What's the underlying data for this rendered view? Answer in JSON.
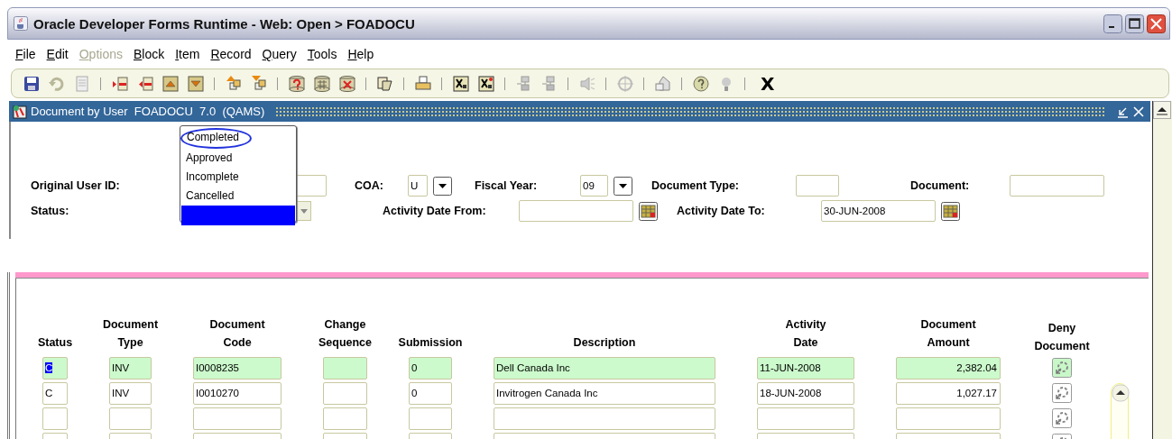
{
  "window": {
    "title": "Oracle Developer Forms Runtime - Web:  Open > FOADOCU"
  },
  "menu": [
    {
      "label": "File",
      "disabled": false
    },
    {
      "label": "Edit",
      "disabled": false
    },
    {
      "label": "Options",
      "disabled": true
    },
    {
      "label": "Block",
      "disabled": false
    },
    {
      "label": "Item",
      "disabled": false
    },
    {
      "label": "Record",
      "disabled": false
    },
    {
      "label": "Query",
      "disabled": false
    },
    {
      "label": "Tools",
      "disabled": false
    },
    {
      "label": "Help",
      "disabled": false
    }
  ],
  "toolbar": {
    "exit_label": "X"
  },
  "form": {
    "title": "Document by User  FOADOCU  7.0  (QAMS)",
    "original_user_id": {
      "label": "Original User ID:"
    },
    "status": {
      "label": "Status:"
    },
    "coa": {
      "label": "COA:",
      "value": "U"
    },
    "fiscal_year": {
      "label": "Fiscal Year:",
      "value": "09"
    },
    "document_type": {
      "label": "Document Type:"
    },
    "document": {
      "label": "Document:"
    },
    "activity_date_from": {
      "label": "Activity Date From:"
    },
    "activity_date_to": {
      "label": "Activity Date To:",
      "value": "30-JUN-2008"
    }
  },
  "status_dropdown": {
    "options": [
      {
        "label": "Completed",
        "selected": false,
        "circled": true
      },
      {
        "label": "Approved",
        "selected": false,
        "circled": false
      },
      {
        "label": "Incomplete",
        "selected": false,
        "circled": false
      },
      {
        "label": "Cancelled",
        "selected": false,
        "circled": false
      }
    ],
    "blank_option_selected": true
  },
  "table": {
    "columns": [
      {
        "heading": [
          "Status"
        ]
      },
      {
        "heading": [
          "Document",
          "Type"
        ]
      },
      {
        "heading": [
          "Document",
          "Code"
        ]
      },
      {
        "heading": [
          "Change",
          "Sequence"
        ]
      },
      {
        "heading": [
          "Submission"
        ]
      },
      {
        "heading": [
          "Description"
        ]
      },
      {
        "heading": [
          "Activity",
          "Date"
        ]
      },
      {
        "heading": [
          "Document",
          "Amount"
        ]
      },
      {
        "heading": [
          "Deny",
          "Document"
        ]
      }
    ],
    "rows": [
      {
        "current": true,
        "text_selected": true,
        "cells": [
          "C",
          "INV",
          "I0008235",
          null,
          "0",
          "Dell Canada Inc",
          "11-JUN-2008",
          "2,382.04"
        ]
      },
      {
        "current": false,
        "text_selected": false,
        "cells": [
          "C",
          "INV",
          "I0010270",
          null,
          "0",
          "Invitrogen Canada Inc",
          "18-JUN-2008",
          "1,027.17"
        ]
      },
      {
        "current": false,
        "text_selected": false,
        "cells": [
          null,
          null,
          null,
          null,
          null,
          null,
          null,
          null
        ]
      },
      {
        "current": false,
        "text_selected": false,
        "cells": [
          null,
          null,
          null,
          null,
          null,
          null,
          null,
          null
        ]
      }
    ]
  }
}
